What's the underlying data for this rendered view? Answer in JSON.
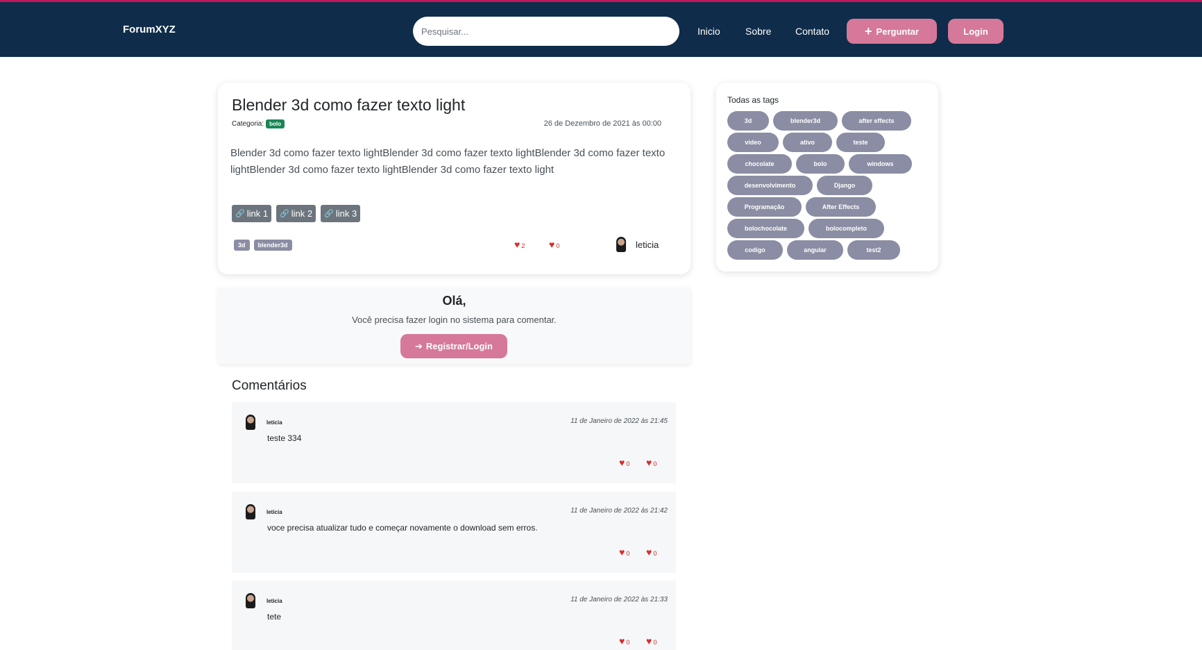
{
  "nav": {
    "brand": "ForumXYZ",
    "search_placeholder": "Pesquisar...",
    "links": [
      "Inicio",
      "Sobre",
      "Contato"
    ],
    "ask_label": "Perguntar",
    "login_label": "Login"
  },
  "question": {
    "title": "Blender 3d como fazer texto light",
    "category_label": "Categoria:",
    "category": "bolo",
    "date": "26 de Dezembro de 2021 às 00:00",
    "body": "Blender 3d como fazer texto lightBlender 3d como fazer texto lightBlender 3d como fazer texto lightBlender 3d como fazer texto lightBlender 3d como fazer texto light",
    "links": [
      "link 1",
      "link 2",
      "link 3"
    ],
    "tags": [
      "3d",
      "blender3d"
    ],
    "likes": "2",
    "dislikes": "0",
    "author": "leticia"
  },
  "login_prompt": {
    "greeting": "Olá,",
    "message": "Você precisa fazer login no sistema para comentar.",
    "button": "Registrar/Login"
  },
  "comments": {
    "title": "Comentários",
    "items": [
      {
        "user": "leticia",
        "date": "11 de Janeiro de 2022 às 21:45",
        "text": "teste 334",
        "likes": "0",
        "dislikes": "0"
      },
      {
        "user": "leticia",
        "date": "11 de Janeiro de 2022 às 21:42",
        "text": "voce precisa atualizar tudo e começar novamente o download sem erros.",
        "likes": "0",
        "dislikes": "0"
      },
      {
        "user": "leticia",
        "date": "11 de Janeiro de 2022 às 21:33",
        "text": "tete",
        "likes": "0",
        "dislikes": "0"
      }
    ]
  },
  "sidebar": {
    "title": "Todas as tags",
    "tags": [
      "3d",
      "blender3d",
      "after effects",
      "video",
      "ativo",
      "teste",
      "chocolate",
      "bolo",
      "windows",
      "desenvolvimento",
      "Django",
      "Programação",
      "After Effects",
      "bolochocolate",
      "bolocompleto",
      "codigo",
      "angular",
      "test2"
    ]
  },
  "colors": {
    "navbar": "#0f2d4a",
    "accent_pink": "#d6789a",
    "tag_gray": "#8a8da3",
    "heart_red": "#d32f2f",
    "category_green": "#198754"
  }
}
